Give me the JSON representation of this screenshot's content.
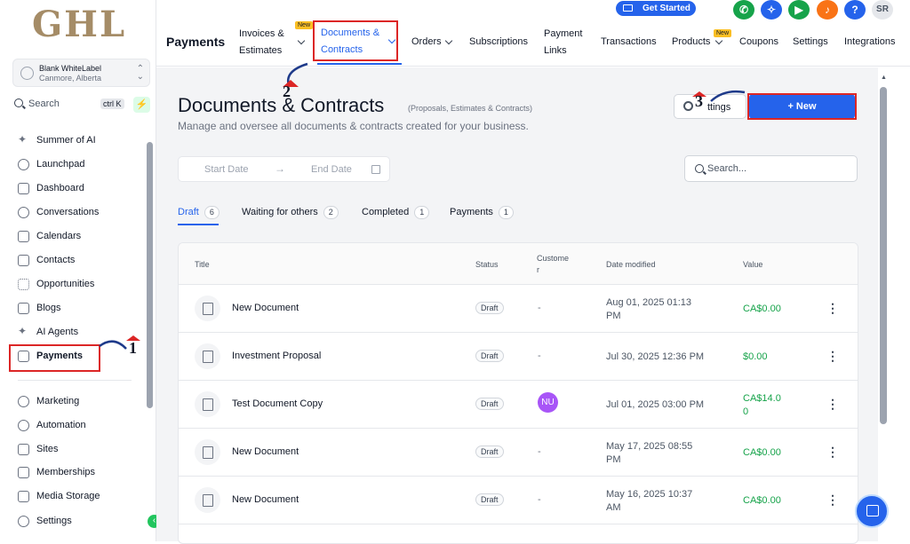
{
  "brand": {
    "logo_text": "GHL",
    "accent_color": "#2563eb"
  },
  "account": {
    "name": "Blank WhiteLabel",
    "location": "Canmore, Alberta"
  },
  "sidebar": {
    "search_label": "Search",
    "search_shortcut": "ctrl K",
    "items": [
      {
        "label": "Summer of AI",
        "icon": "sparkle-icon"
      },
      {
        "label": "Launchpad",
        "icon": "rocket-icon"
      },
      {
        "label": "Dashboard",
        "icon": "grid-icon"
      },
      {
        "label": "Conversations",
        "icon": "chat-icon"
      },
      {
        "label": "Calendars",
        "icon": "calendar-icon"
      },
      {
        "label": "Contacts",
        "icon": "contacts-icon"
      },
      {
        "label": "Opportunities",
        "icon": "opportunities-icon"
      },
      {
        "label": "Blogs",
        "icon": "box-icon"
      },
      {
        "label": "AI Agents",
        "icon": "sparkle-icon"
      },
      {
        "label": "Payments",
        "icon": "receipt-icon"
      },
      {
        "label": "Marketing",
        "icon": "send-icon"
      },
      {
        "label": "Automation",
        "icon": "automation-icon"
      },
      {
        "label": "Sites",
        "icon": "globe-icon"
      },
      {
        "label": "Memberships",
        "icon": "membership-icon"
      },
      {
        "label": "Media Storage",
        "icon": "image-icon"
      },
      {
        "label": "Settings",
        "icon": "gear-icon"
      }
    ]
  },
  "topbar": {
    "get_started": "Get Started",
    "avatar": "SR",
    "help": "?",
    "section_title": "Payments",
    "tabs": [
      {
        "line1": "Invoices &",
        "line2": "Estimates",
        "badge": "New"
      },
      {
        "line1": "Documents &",
        "line2": "Contracts"
      },
      {
        "line1": "Orders"
      },
      {
        "line1": "Subscriptions"
      },
      {
        "line1": "Payment",
        "line2": "Links"
      },
      {
        "line1": "Transactions"
      },
      {
        "line1": "Products",
        "badge": "New"
      },
      {
        "line1": "Coupons"
      },
      {
        "line1": "Settings"
      },
      {
        "line1": "Integrations"
      }
    ]
  },
  "page": {
    "title": "Documents & Contracts",
    "subtitle": "(Proposals, Estimates & Contracts)",
    "description": "Manage and oversee all documents & contracts created for your business.",
    "settings_label": "ttings",
    "new_label": "+ New",
    "start_date": "Start Date",
    "end_date": "End Date",
    "search_placeholder": "Search..."
  },
  "status_tabs": [
    {
      "label": "Draft",
      "count": "6"
    },
    {
      "label": "Waiting for others",
      "count": "2"
    },
    {
      "label": "Completed",
      "count": "1"
    },
    {
      "label": "Payments",
      "count": "1"
    }
  ],
  "table": {
    "headers": {
      "title": "Title",
      "status": "Status",
      "customer_1": "Custome",
      "customer_2": "r",
      "date": "Date modified",
      "value": "Value"
    },
    "rows": [
      {
        "title": "New Document",
        "status": "Draft",
        "customer": "-",
        "date_1": "Aug 01, 2025 01:13",
        "date_2": "PM",
        "value_1": "CA$0.00",
        "value_2": ""
      },
      {
        "title": "Investment Proposal",
        "status": "Draft",
        "customer": "-",
        "date_1": "Jul 30, 2025 12:36 PM",
        "date_2": "",
        "value_1": "$0.00",
        "value_2": ""
      },
      {
        "title": "Test Document Copy",
        "status": "Draft",
        "customer": "NU",
        "date_1": "Jul 01, 2025 03:00 PM",
        "date_2": "",
        "value_1": "CA$14.0",
        "value_2": "0"
      },
      {
        "title": "New Document",
        "status": "Draft",
        "customer": "-",
        "date_1": "May 17, 2025 08:55",
        "date_2": "PM",
        "value_1": "CA$0.00",
        "value_2": ""
      },
      {
        "title": "New Document",
        "status": "Draft",
        "customer": "-",
        "date_1": "May 16, 2025 10:37",
        "date_2": "AM",
        "value_1": "CA$0.00",
        "value_2": ""
      }
    ]
  },
  "annotations": [
    "1",
    "2",
    "3"
  ]
}
